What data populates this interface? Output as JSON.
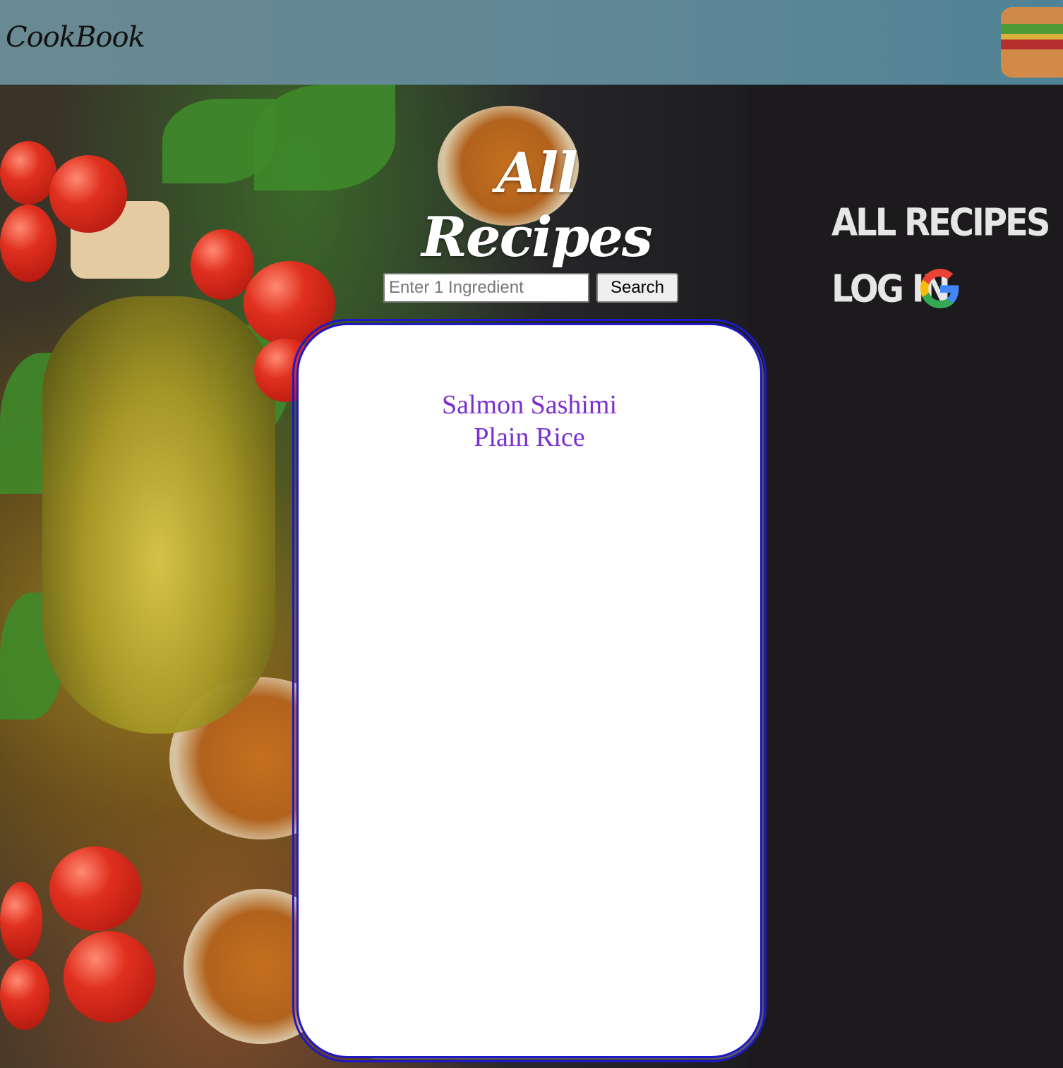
{
  "header": {
    "brand": "CookBook",
    "menu_icon": "hamburger-icon"
  },
  "main": {
    "title": "All Recipes",
    "search": {
      "placeholder": "Enter 1 Ingredient",
      "value": "",
      "button_label": "Search"
    },
    "results": [
      "Salmon Sashimi",
      "Plain Rice"
    ]
  },
  "nav": {
    "all_recipes": "ALL RECIPES",
    "log_in": "LOG IN",
    "login_icon": "google-icon"
  },
  "colors": {
    "header_bg": "#5f8796",
    "result_link": "#7a2fd0",
    "card_border": "#1f18c9",
    "page_bg": "#1c1a1d"
  }
}
